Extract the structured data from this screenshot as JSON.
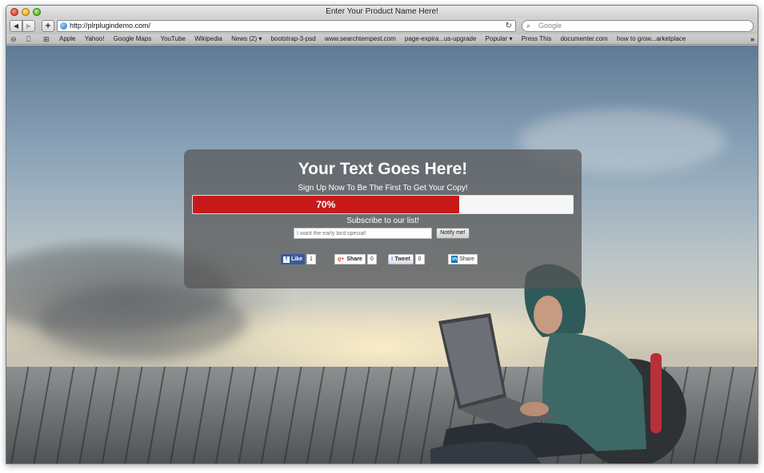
{
  "window": {
    "title": "Enter Your Product Name Here!"
  },
  "toolbar": {
    "back_icon": "◀",
    "forward_icon": "▶",
    "add_icon": "+",
    "url": "http://plrplugindemo.com/",
    "reload_icon": "↻",
    "search_placeholder": "Google",
    "search_icon": "⌕"
  },
  "bookmarks": {
    "icons": [
      "reading-list-icon",
      "book-icon",
      "grid-icon"
    ],
    "items": [
      {
        "label": "Apple"
      },
      {
        "label": "Yahoo!"
      },
      {
        "label": "Google Maps"
      },
      {
        "label": "YouTube"
      },
      {
        "label": "Wikipedia"
      },
      {
        "label": "News (2) ▾"
      },
      {
        "label": "bootstrap-3-psd"
      },
      {
        "label": "www.searchtempest.com"
      },
      {
        "label": "page-expira...us-upgrade"
      },
      {
        "label": "Popular ▾"
      },
      {
        "label": "Press This"
      },
      {
        "label": "documenter.com"
      },
      {
        "label": "how to grow...arketplace"
      }
    ],
    "overflow_icon": "»"
  },
  "promo": {
    "headline": "Your Text Goes Here!",
    "subline": "Sign Up Now To Be The First To Get Your Copy!",
    "progress": {
      "percent": 70,
      "label": "70%",
      "fill_color": "#c8191a"
    },
    "subscribe_title": "Subscribe to our list!",
    "email_placeholder": "I want the early bird special!",
    "notify_label": "Notify me!"
  },
  "social": {
    "facebook": {
      "label": "Like",
      "count": "1",
      "icon": "f"
    },
    "google": {
      "label": "Share",
      "count": "0",
      "icon": "g+"
    },
    "twitter": {
      "label": "Tweet",
      "count": "0",
      "icon": "t"
    },
    "linkedin": {
      "label": "Share",
      "icon": "in"
    }
  }
}
